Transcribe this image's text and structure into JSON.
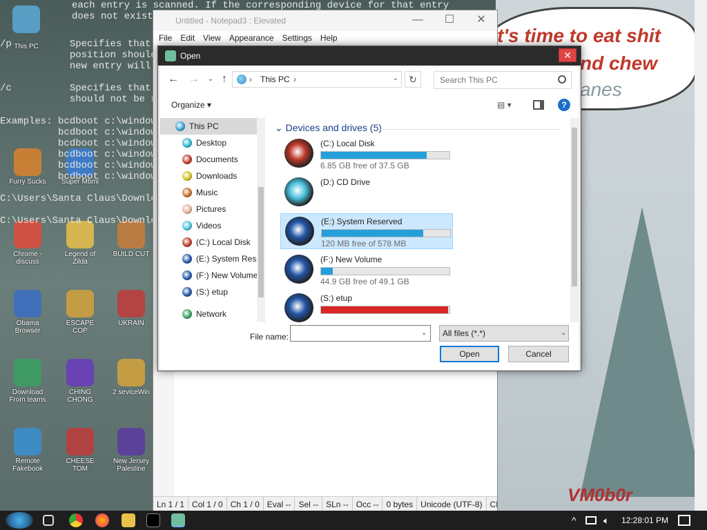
{
  "console": {
    "top_line1": "each entry is scanned. If the corresponding device for that entry",
    "top_line2": "does not exist,",
    "lines": [
      "",
      "",
      "",
      "/p          Specifies that",
      "            position should",
      "            new entry will",
      "",
      "/c          Specifies that",
      "            should not be r",
      "",
      "Examples: bcdboot c:\\windows",
      "          bcdboot c:\\windows",
      "          bcdboot c:\\windows",
      "          bcdboot c:\\windows",
      "          bcdboot c:\\windows",
      "          bcdboot c:\\windows",
      "",
      "C:\\Users\\Santa Claus\\Downloa",
      "",
      "C:\\Users\\Santa Claus\\Downloa"
    ]
  },
  "desktop": {
    "speech_line1": "t's time to eat shit",
    "speech_line2": "nd chew",
    "speech_line3": "anes",
    "watermark": "VM0b0r",
    "icons": [
      {
        "label": "This PC"
      },
      {
        "label": "Furry Sucks"
      },
      {
        "label": "Super Mbml"
      },
      {
        "label": "Chrome - discuss"
      },
      {
        "label": "Legend of Zilda"
      },
      {
        "label": "BUILD CUT"
      },
      {
        "label": "Obama Browser"
      },
      {
        "label": "ESCAPE COP"
      },
      {
        "label": "UKRAIN"
      },
      {
        "label": "Download From teams"
      },
      {
        "label": "CHING CHONG"
      },
      {
        "label": "2 seviceWin"
      },
      {
        "label": "Remote Fakebook"
      },
      {
        "label": "CHEESE TOM"
      },
      {
        "label": "New Jersey Palestine"
      }
    ]
  },
  "notepad": {
    "title": "Untitled - Notepad3 : Elevated",
    "menu": [
      "File",
      "Edit",
      "View",
      "Appearance",
      "Settings",
      "Help"
    ],
    "status": [
      "Ln 1 / 1",
      "Col 1 / 0",
      "Ch 1 / 0",
      "Eval --",
      "Sel --",
      "SLn --",
      "Occ --",
      "0 bytes",
      "Unicode (UTF-8)",
      "CR+"
    ]
  },
  "dialog": {
    "title": "Open",
    "close_glyph": "✕",
    "address": {
      "location": "This PC",
      "sep": "›"
    },
    "search_placeholder": "Search This PC",
    "organize_label": "Organize",
    "help_glyph": "?",
    "nav": [
      {
        "label": "This PC",
        "selected": true,
        "color": "#3aa0d8"
      },
      {
        "label": "Desktop",
        "color": "#2fb5c9"
      },
      {
        "label": "Documents",
        "color": "#c0392b"
      },
      {
        "label": "Downloads",
        "color": "#d4c21e"
      },
      {
        "label": "Music",
        "color": "#c96f2b"
      },
      {
        "label": "Pictures",
        "color": "#e6b49a"
      },
      {
        "label": "Videos",
        "color": "#4ac2e0"
      },
      {
        "label": "(C:) Local Disk",
        "color": "#c0392b"
      },
      {
        "label": "(E:) System Rese",
        "color": "#2256a8"
      },
      {
        "label": "(F:) New Volume",
        "color": "#2256a8"
      },
      {
        "label": "(S:) etup",
        "color": "#2256a8"
      },
      {
        "label": "Network",
        "color": "#3aa060"
      }
    ],
    "group_header": "Devices and drives (5)",
    "drives": [
      {
        "label": "(C:) Local Disk",
        "free": "6.85 GB free of 37.5 GB",
        "used_fraction": 0.82,
        "bar_color": "#26a0da",
        "selected": false,
        "has_bar": true,
        "icon_color": "#c0392b"
      },
      {
        "label": "(D:) CD Drive",
        "free": "",
        "used_fraction": 0,
        "bar_color": "#26a0da",
        "selected": false,
        "has_bar": false,
        "icon_color": "#4ac2e0"
      },
      {
        "label": "(E:) System Reserved",
        "free": "120 MB free of 578 MB",
        "used_fraction": 0.79,
        "bar_color": "#26a0da",
        "selected": true,
        "has_bar": true,
        "icon_color": "#2256a8"
      },
      {
        "label": "(F:) New Volume",
        "free": "44.9 GB free of 49.1 GB",
        "used_fraction": 0.09,
        "bar_color": "#26a0da",
        "selected": false,
        "has_bar": true,
        "icon_color": "#2256a8"
      },
      {
        "label": "(S:) etup",
        "free": "",
        "used_fraction": 0.99,
        "bar_color": "#da2626",
        "selected": false,
        "has_bar": true,
        "icon_color": "#2256a8"
      }
    ],
    "filename_label": "File name:",
    "filename_value": "",
    "filter_value": "All files (*.*)",
    "open_label": "Open",
    "cancel_label": "Cancel"
  },
  "taskbar": {
    "clock": "12:28:01 PM",
    "tray_up": "^"
  },
  "colors": {
    "accent": "#0078d7",
    "bar_blue": "#26a0da",
    "bar_red": "#da2626",
    "title_bar": "#2b2b2b",
    "close_red": "#e04343"
  }
}
